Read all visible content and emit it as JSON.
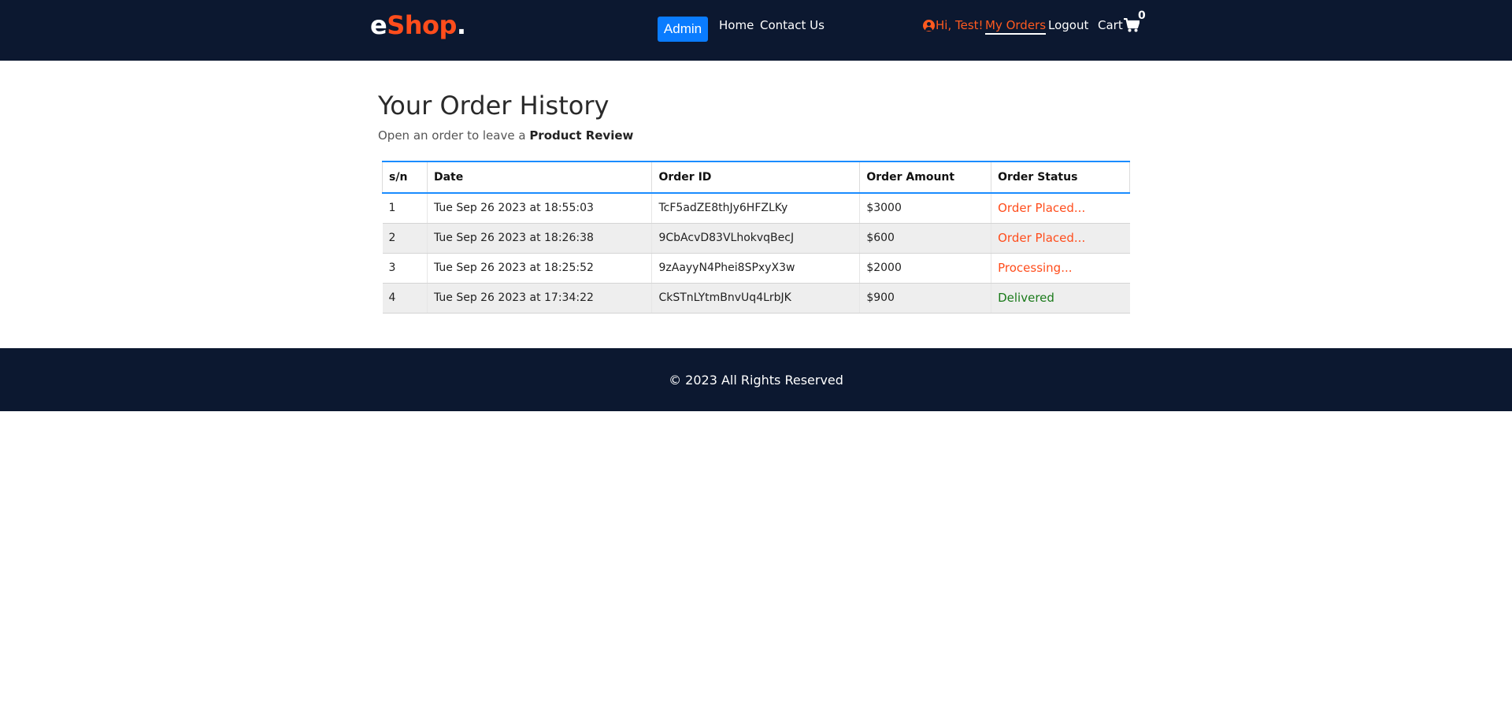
{
  "header": {
    "logo": {
      "prefix": "e",
      "accent": "Shop",
      "suffix": "."
    },
    "admin_label": "Admin",
    "nav": {
      "home": "Home",
      "contact": "Contact Us"
    },
    "user_greeting": "Hi, Test!",
    "my_orders": "My Orders",
    "logout": "Logout",
    "cart_label": "Cart",
    "cart_count": "0"
  },
  "main": {
    "title": "Your Order History",
    "subtitle_prefix": "Open an order to leave a ",
    "subtitle_bold": "Product Review",
    "columns": [
      "s/n",
      "Date",
      "Order ID",
      "Order Amount",
      "Order Status"
    ],
    "orders": [
      {
        "sn": "1",
        "date": "Tue Sep 26 2023 at 18:55:03",
        "id": "TcF5adZE8thJy6HFZLKy",
        "amount": "$3000",
        "status": "Order Placed...",
        "status_color": "#ff4d1c"
      },
      {
        "sn": "2",
        "date": "Tue Sep 26 2023 at 18:26:38",
        "id": "9CbAcvD83VLhokvqBecJ",
        "amount": "$600",
        "status": "Order Placed...",
        "status_color": "#ff4d1c"
      },
      {
        "sn": "3",
        "date": "Tue Sep 26 2023 at 18:25:52",
        "id": "9zAayyN4Phei8SPxyX3w",
        "amount": "$2000",
        "status": "Processing...",
        "status_color": "#ff4d1c"
      },
      {
        "sn": "4",
        "date": "Tue Sep 26 2023 at 17:34:22",
        "id": "CkSTnLYtmBnvUq4LrbJK",
        "amount": "$900",
        "status": "Delivered",
        "status_color": "#1a7a1a"
      }
    ]
  },
  "footer": {
    "text": "© 2023 All Rights Reserved"
  },
  "colors": {
    "header_bg": "#0c1830",
    "accent": "#ff4d1c",
    "admin_button": "#0a7cff",
    "table_border": "#1a8cff"
  }
}
